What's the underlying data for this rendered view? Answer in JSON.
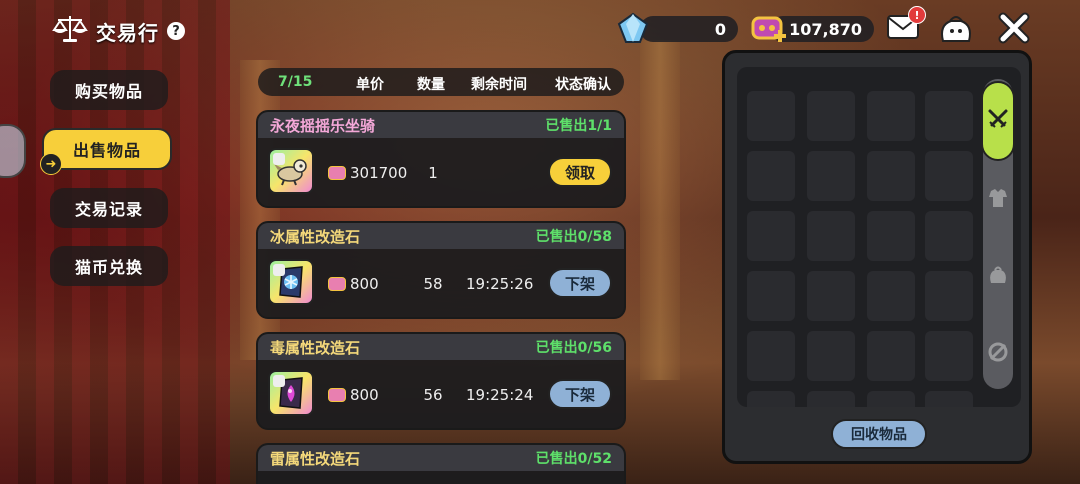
{
  "header": {
    "title": "交易行",
    "help_glyph": "?",
    "currency": {
      "gems": "0",
      "coins": "107,870"
    },
    "mail_badge": "!"
  },
  "nav": {
    "items": [
      {
        "label": "购买物品",
        "active": false
      },
      {
        "label": "出售物品",
        "active": true
      },
      {
        "label": "交易记录",
        "active": false
      },
      {
        "label": "猫币兑换",
        "active": false
      }
    ]
  },
  "table_header": {
    "count": "7/15",
    "unit_price": "单价",
    "quantity": "数量",
    "time_left": "剩余时间",
    "status": "状态确认"
  },
  "listings": [
    {
      "name": "永夜摇摇乐坐骑",
      "name_color": "#f4a8d8",
      "sold": "已售出1/1",
      "price": "301700",
      "qty": "1",
      "time": "",
      "action": "领取",
      "action_type": "claim",
      "rarity": "SR",
      "icon_bg": "linear-gradient(135deg,#9af0a0,#f7e56a,#f08ad0)"
    },
    {
      "name": "冰属性改造石",
      "name_color": "#f4d87a",
      "sold": "已售出0/58",
      "price": "800",
      "qty": "58",
      "time": "19:25:26",
      "action": "下架",
      "action_type": "delist",
      "rarity": "SR",
      "icon_bg": "linear-gradient(135deg,#9af0a0,#f7e56a,#f08ad0)"
    },
    {
      "name": "毒属性改造石",
      "name_color": "#f4d87a",
      "sold": "已售出0/56",
      "price": "800",
      "qty": "56",
      "time": "19:25:24",
      "action": "下架",
      "action_type": "delist",
      "rarity": "SR",
      "icon_bg": "linear-gradient(135deg,#9af0a0,#f7e56a,#f08ad0)"
    },
    {
      "name": "雷属性改造石",
      "name_color": "#f4d87a",
      "sold": "已售出0/52",
      "price": "",
      "qty": "",
      "time": "",
      "action": "",
      "action_type": "none",
      "rarity": "",
      "icon_bg": ""
    }
  ],
  "inventory": {
    "recycle_label": "回收物品",
    "tabs": [
      "swords-icon",
      "armor-icon",
      "bag-icon",
      "gear-swirl-icon"
    ]
  }
}
